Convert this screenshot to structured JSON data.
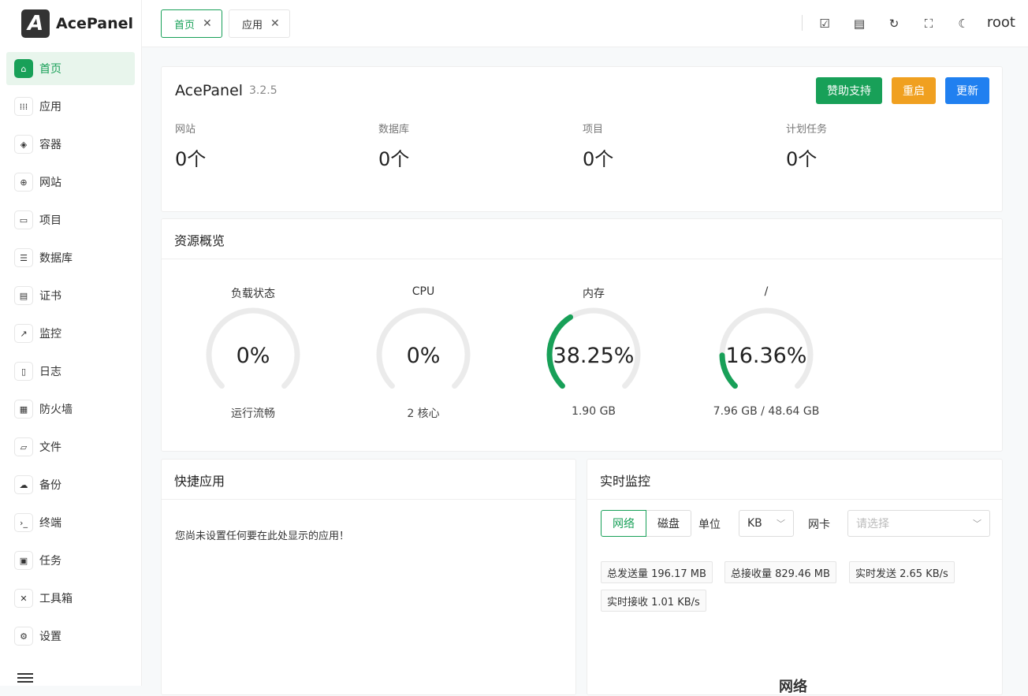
{
  "brand": {
    "logo_letter": "A",
    "name": "AcePanel"
  },
  "sidebar": {
    "items": [
      {
        "label": "首页",
        "icon": "home-icon",
        "glyph": "⌂",
        "active": true
      },
      {
        "label": "应用",
        "icon": "apps-grid-icon",
        "glyph": "⁞⁞⁞"
      },
      {
        "label": "容器",
        "icon": "layers-icon",
        "glyph": "◈"
      },
      {
        "label": "网站",
        "icon": "globe-icon",
        "glyph": "⊕"
      },
      {
        "label": "项目",
        "icon": "folder-stack-icon",
        "glyph": "▭"
      },
      {
        "label": "数据库",
        "icon": "database-icon",
        "glyph": "☰"
      },
      {
        "label": "证书",
        "icon": "certificate-icon",
        "glyph": "▤"
      },
      {
        "label": "监控",
        "icon": "chart-line-icon",
        "glyph": "↗"
      },
      {
        "label": "日志",
        "icon": "document-icon",
        "glyph": "▯"
      },
      {
        "label": "防火墙",
        "icon": "firewall-icon",
        "glyph": "▦"
      },
      {
        "label": "文件",
        "icon": "folder-icon",
        "glyph": "▱"
      },
      {
        "label": "备份",
        "icon": "cloud-upload-icon",
        "glyph": "☁"
      },
      {
        "label": "终端",
        "icon": "terminal-icon",
        "glyph": "›_"
      },
      {
        "label": "任务",
        "icon": "task-icon",
        "glyph": "▣"
      },
      {
        "label": "工具箱",
        "icon": "tools-icon",
        "glyph": "✕"
      },
      {
        "label": "设置",
        "icon": "gear-icon",
        "glyph": "⚙"
      }
    ]
  },
  "header": {
    "tabs": [
      {
        "label": "首页",
        "active": true
      },
      {
        "label": "应用",
        "active": false
      }
    ],
    "close_glyph": "✕",
    "icons": [
      {
        "name": "checkbox-icon",
        "glyph": "☑"
      },
      {
        "name": "file-icon",
        "glyph": "▤"
      },
      {
        "name": "refresh-icon",
        "glyph": "↻"
      },
      {
        "name": "fullscreen-icon",
        "glyph": "⛶"
      },
      {
        "name": "moon-icon",
        "glyph": "☾"
      }
    ],
    "user": "root"
  },
  "overview": {
    "app_name": "AcePanel",
    "version": "3.2.5",
    "buttons": {
      "sponsor": "赞助支持",
      "restart": "重启",
      "update": "更新"
    },
    "stats": [
      {
        "label": "网站",
        "value": "0个"
      },
      {
        "label": "数据库",
        "value": "0个"
      },
      {
        "label": "项目",
        "value": "0个"
      },
      {
        "label": "计划任务",
        "value": "0个"
      }
    ]
  },
  "resources": {
    "title": "资源概览",
    "gauges": [
      {
        "label": "负载状态",
        "value_text": "0%",
        "percent": 0,
        "sub": "运行流畅"
      },
      {
        "label": "CPU",
        "value_text": "0%",
        "percent": 0,
        "sub": "2 核心"
      },
      {
        "label": "内存",
        "value_text": "38.25%",
        "percent": 38.25,
        "sub": "1.90 GB"
      },
      {
        "label": "/",
        "value_text": "16.36%",
        "percent": 16.36,
        "sub": "7.96 GB / 48.64 GB"
      }
    ],
    "colors": {
      "track": "#ebebeb",
      "fill": "#18a058"
    }
  },
  "quick_apps": {
    "title": "快捷应用",
    "empty_text": "您尚未设置任何要在此处显示的应用！"
  },
  "monitor": {
    "title": "实时监控",
    "segments": [
      "网络",
      "磁盘"
    ],
    "unit_label": "单位",
    "unit_value": "KB",
    "nic_label": "网卡",
    "nic_placeholder": "请选择",
    "tags": [
      "总发送量 196.17 MB",
      "总接收量 829.46 MB",
      "实时发送 2.65 KB/s",
      "实时接收 1.01 KB/s"
    ],
    "chart_title": "网络"
  }
}
